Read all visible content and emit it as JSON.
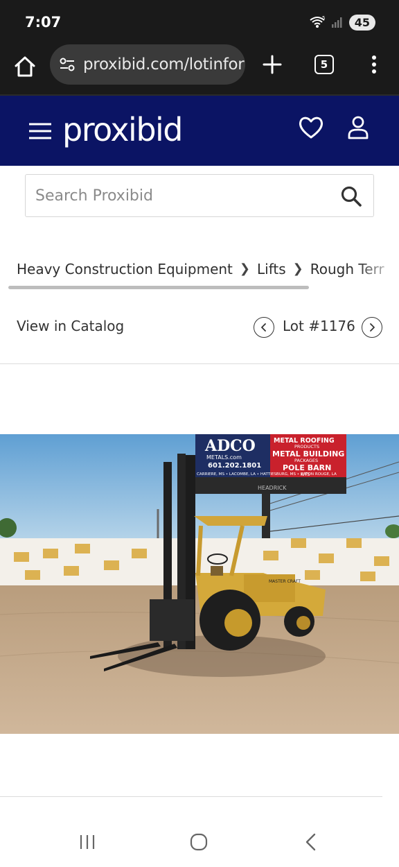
{
  "status_bar": {
    "time": "7:07",
    "battery": "45",
    "icons": [
      "wifi-icon",
      "signal-icon",
      "battery-icon"
    ]
  },
  "browser": {
    "url": "proxibid.com/lotinfor",
    "tab_count": "5",
    "icons": [
      "home-icon",
      "site-settings-icon",
      "new-tab-icon",
      "tab-switcher-icon",
      "more-menu-icon"
    ]
  },
  "header": {
    "logo": "proxibid",
    "background": "#0b1464",
    "icons": [
      "hamburger-menu-icon",
      "heart-icon",
      "user-icon"
    ]
  },
  "search": {
    "placeholder": "Search Proxibid",
    "value": ""
  },
  "breadcrumb": {
    "items": [
      {
        "label": "Heavy Construction Equipment"
      },
      {
        "label": "Lifts"
      },
      {
        "label": "Rough Terr"
      }
    ]
  },
  "catalog": {
    "view_label": "View in Catalog",
    "lot_label": "Lot #1176"
  },
  "photo": {
    "billboard_brand": "ADCO",
    "billboard_brand_sub": "METALS.com",
    "billboard_phone": "601.202.1801",
    "billboard_cities": "CARRIERE, MS • LACOMBE, LA • HATTIESBURG, MS • BATON ROUGE, LA",
    "billboard_line1": "METAL ROOFING",
    "billboard_line2": "PRODUCTS",
    "billboard_line3": "METAL BUILDING",
    "billboard_line4": "PACKAGES",
    "billboard_line5": "POLE BARN",
    "billboard_line6": "KITS",
    "billboard_footer": "HEADRICK",
    "machine_badge": "MASTER CRAFT"
  },
  "nav_bar": {
    "icons": [
      "recent-apps-icon",
      "home-circle-icon",
      "back-icon"
    ]
  }
}
